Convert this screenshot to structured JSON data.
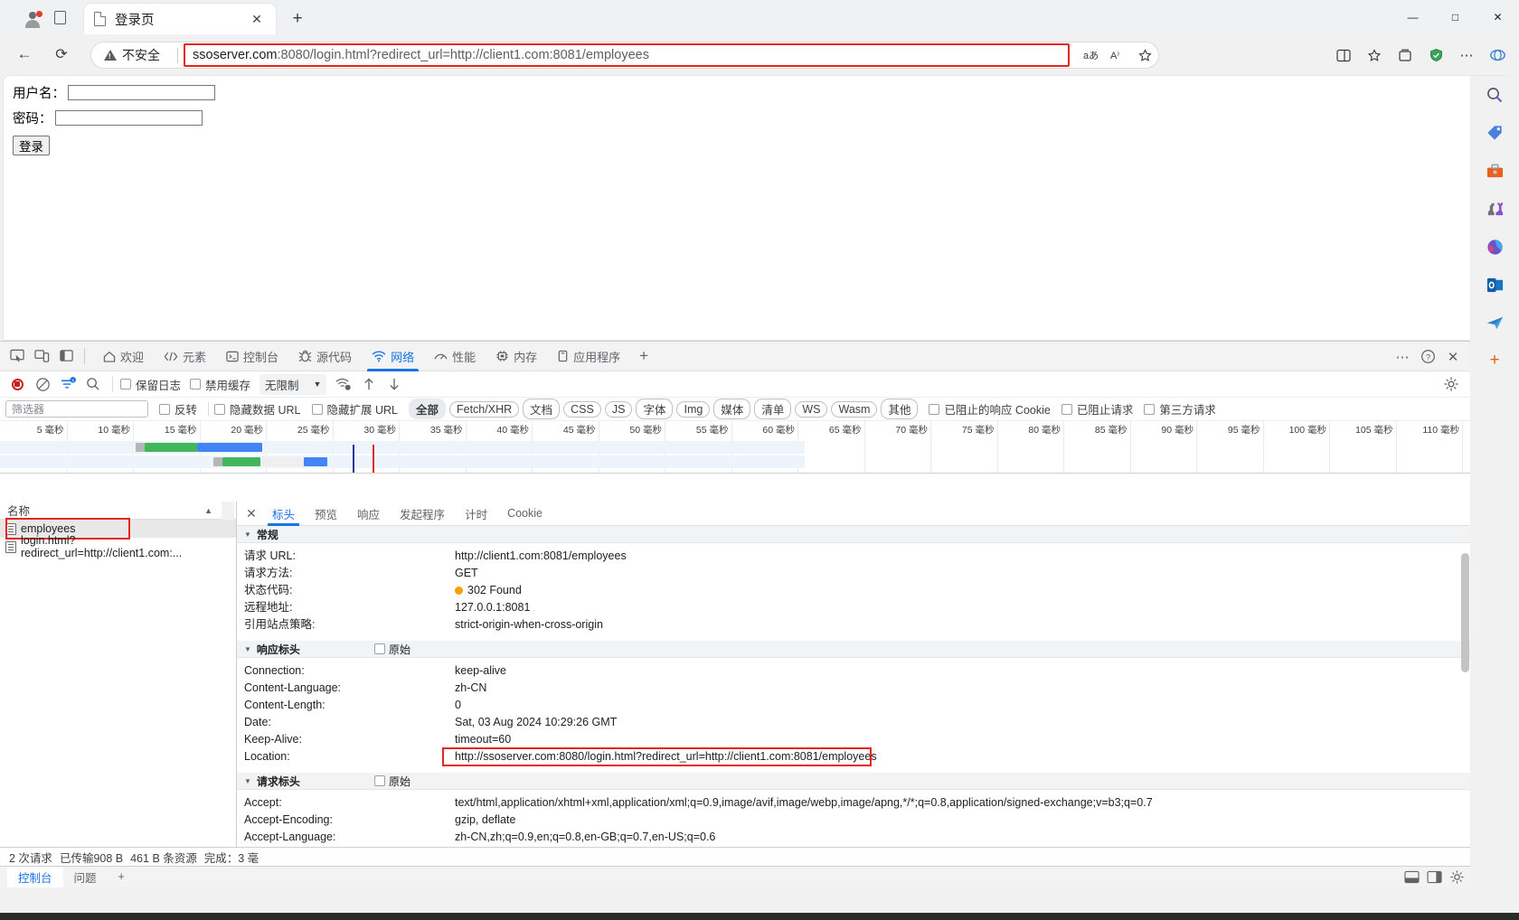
{
  "browser": {
    "tab": {
      "title": "登录页",
      "favicon": "page-icon",
      "close": "✕"
    },
    "newtab_label": "+",
    "window_controls": {
      "minimize": "—",
      "maximize": "□",
      "close": "✕"
    },
    "nav": {
      "back": "←",
      "reload": "⟳"
    },
    "security": {
      "label": "不安全",
      "icon": "warning-triangle-icon"
    },
    "url": {
      "host": "ssoserver.com",
      "rest": ":8080/login.html?redirect_url=http://client1.com:8081/employees",
      "full": "ssoserver.com:8080/login.html?redirect_url=http://client1.com:8081/employees"
    },
    "omni_actions": [
      "aA",
      "A))",
      "☆"
    ],
    "nav_right_icons": [
      "split-screen-icon",
      "favorites-icon",
      "collections-icon",
      "browser-essentials-icon",
      "settings-more-icon",
      "copilot-icon"
    ],
    "edgebar_icons": [
      "search-icon",
      "tag-icon",
      "toolbox-icon",
      "games-icon",
      "office-icon",
      "outlook-icon",
      "send-icon",
      "add-icon"
    ]
  },
  "page": {
    "username_label": "用户名：",
    "password_label": "密码：",
    "username_value": "",
    "password_value": "",
    "login_button": "登录"
  },
  "devtools": {
    "dock_icons": [
      "inspect-element-icon",
      "device-toolbar-icon",
      "dock-side-icon"
    ],
    "tabs": [
      {
        "label": "欢迎",
        "icon": "home-icon",
        "active": false
      },
      {
        "label": "元素",
        "icon": "code-icon",
        "active": false
      },
      {
        "label": "控制台",
        "icon": "console-icon",
        "active": false
      },
      {
        "label": "源代码",
        "icon": "sources-icon",
        "active": false
      },
      {
        "label": "网络",
        "icon": "network-icon",
        "active": true
      },
      {
        "label": "性能",
        "icon": "performance-icon",
        "active": false
      },
      {
        "label": "内存",
        "icon": "memory-icon",
        "active": false
      },
      {
        "label": "应用程序",
        "icon": "application-icon",
        "active": false
      }
    ],
    "tabs_more": "+",
    "right_buttons": [
      "more-options-icon",
      "help-icon",
      "close-devtools-icon"
    ],
    "network_toolbar": {
      "record_label": "record-button",
      "clear_label": "clear-button",
      "filter_toggle_label": "filter-toggle-button",
      "search_label": "search-button",
      "preserve_log": "保留日志",
      "disable_cache": "禁用缓存",
      "throttle": "无限制",
      "throttle_caret": "▼",
      "network_conditions": "network-conditions-icon",
      "import_har": "import-har-icon",
      "export_har": "export-har-icon",
      "settings": "settings-icon"
    },
    "filter_bar": {
      "placeholder": "筛选器",
      "value": "",
      "invert": "反转",
      "hide_data_urls": "隐藏数据 URL",
      "hide_ext_urls": "隐藏扩展 URL",
      "types": [
        "全部",
        "Fetch/XHR",
        "文档",
        "CSS",
        "JS",
        "字体",
        "Img",
        "媒体",
        "清单",
        "WS",
        "Wasm",
        "其他"
      ],
      "selected_type": "全部",
      "blocked_cookies": "已阻止的响应 Cookie",
      "blocked_requests": "已阻止请求",
      "third_party": "第三方请求"
    },
    "overview": {
      "unit": "毫秒",
      "ticks": [
        5,
        10,
        15,
        20,
        25,
        30,
        35,
        40,
        45,
        50,
        55,
        60,
        65,
        70,
        75,
        80,
        85,
        90,
        95,
        100,
        105,
        110
      ]
    },
    "requests": {
      "column_header": "名称",
      "sort_arrow": "▲",
      "rows": [
        {
          "name": "employees",
          "selected": true,
          "highlighted": true
        },
        {
          "name": "login.html?redirect_url=http://client1.com:...",
          "selected": false,
          "highlighted": false
        }
      ]
    },
    "detail_tabs": [
      {
        "label": "标头",
        "active": true
      },
      {
        "label": "预览",
        "active": false
      },
      {
        "label": "响应",
        "active": false
      },
      {
        "label": "发起程序",
        "active": false
      },
      {
        "label": "计时",
        "active": false
      },
      {
        "label": "Cookie",
        "active": false
      }
    ],
    "sections": [
      {
        "title": "常规",
        "raw_label": null,
        "rows": [
          {
            "key": "请求 URL:",
            "value": "http://client1.com:8081/employees"
          },
          {
            "key": "请求方法:",
            "value": "GET"
          },
          {
            "key": "状态代码:",
            "value": "302 Found",
            "status_dot": "#f4a100"
          },
          {
            "key": "远程地址:",
            "value": "127.0.0.1:8081"
          },
          {
            "key": "引用站点策略:",
            "value": "strict-origin-when-cross-origin"
          }
        ]
      },
      {
        "title": "响应标头",
        "raw_label": "原始",
        "rows": [
          {
            "key": "Connection:",
            "value": "keep-alive"
          },
          {
            "key": "Content-Language:",
            "value": "zh-CN"
          },
          {
            "key": "Content-Length:",
            "value": "0"
          },
          {
            "key": "Date:",
            "value": "Sat, 03 Aug 2024 10:29:26 GMT"
          },
          {
            "key": "Keep-Alive:",
            "value": "timeout=60"
          },
          {
            "key": "Location:",
            "value": "http://ssoserver.com:8080/login.html?redirect_url=http://client1.com:8081/employees",
            "highlighted": true
          }
        ]
      },
      {
        "title": "请求标头",
        "raw_label": "原始",
        "rows": [
          {
            "key": "Accept:",
            "value": "text/html,application/xhtml+xml,application/xml;q=0.9,image/avif,image/webp,image/apng,*/*;q=0.8,application/signed-exchange;v=b3;q=0.7"
          },
          {
            "key": "Accept-Encoding:",
            "value": "gzip, deflate"
          },
          {
            "key": "Accept-Language:",
            "value": "zh-CN,zh;q=0.9,en;q=0.8,en-GB;q=0.7,en-US;q=0.6"
          }
        ]
      }
    ],
    "status_bar": {
      "requests": "2 次请求",
      "transferred": "已传输908 B",
      "resources": "461 B 条资源",
      "finish": "完成：3 毫"
    },
    "drawer": {
      "tabs": [
        "控制台",
        "问题"
      ],
      "active": "控制台",
      "add": "+",
      "right_icons": [
        "dock-bottom-icon",
        "dock-right-icon",
        "settings-gear-icon"
      ]
    }
  }
}
